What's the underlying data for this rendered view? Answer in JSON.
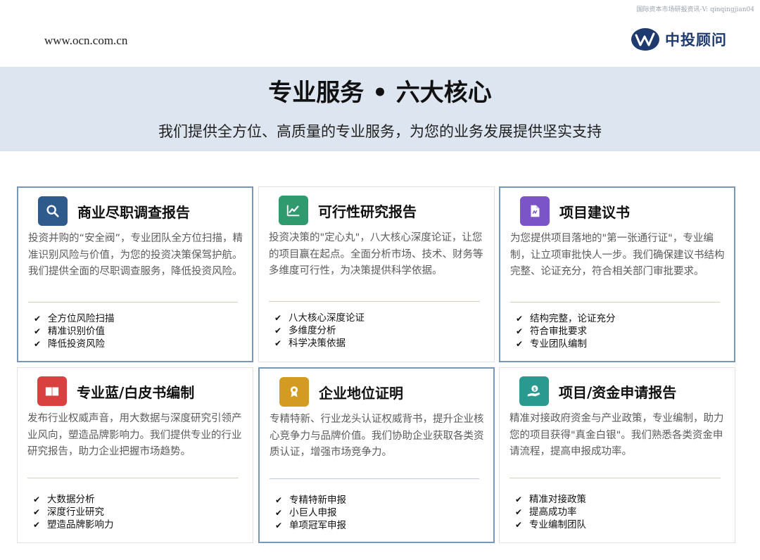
{
  "watermark": "国际资本市场研报资讯-V: qinqingjian04",
  "header": {
    "url": "www.ocn.com.cn",
    "brand_name": "中投顾问",
    "brand_color": "#1e3a6e"
  },
  "banner": {
    "title": "专业服务 • 六大核心",
    "subtitle": "我们提供全方位、高质量的专业服务，为您的业务发展提供坚实支持"
  },
  "cards": [
    {
      "title": "商业尽职调查报告",
      "icon": "search-icon",
      "icon_color": "#2f5a8c",
      "desc": "投资并购的“安全阀”，专业团队全方位扫描，精准识别风险与价值，为您的投资决策保驾护航。我们提供全面的尽职调查服务，降低投资风险。",
      "checks": [
        "全方位风险扫描",
        "精准识别价值",
        "降低投资风险"
      ]
    },
    {
      "title": "可行性研究报告",
      "icon": "line-chart-icon",
      "icon_color": "#2e9a6e",
      "desc": "投资决策的\"定心丸\"，八大核心深度论证，让您的项目赢在起点。全面分析市场、技术、财务等多维度可行性，为决策提供科学依据。",
      "checks": [
        "八大核心深度论证",
        "多维度分析",
        "科学决策依据"
      ]
    },
    {
      "title": "项目建议书",
      "icon": "document-icon",
      "icon_color": "#7b55c7",
      "desc": "为您提供项目落地的\"第一张通行证\"，专业编制，让立项审批快人一步。我们确保建议书结构完整、论证充分，符合相关部门审批要求。",
      "checks": [
        "结构完整，论证充分",
        "符合审批要求",
        "专业团队编制"
      ]
    },
    {
      "title": "专业蓝/白皮书编制",
      "icon": "book-icon",
      "icon_color": "#d94141",
      "desc": "发布行业权威声音，用大数据与深度研究引领产业风向，塑造品牌影响力。我们提供专业的行业研究报告，助力企业把握市场趋势。",
      "checks": [
        "大数据分析",
        "深度行业研究",
        "塑造品牌影响力"
      ]
    },
    {
      "title": "企业地位证明",
      "icon": "award-icon",
      "icon_color": "#d49b22",
      "desc": "专精特新、行业龙头认证权威背书，提升企业核心竞争力与品牌价值。我们协助企业获取各类资质认证，增强市场竞争力。",
      "checks": [
        "专精特新申报",
        "小巨人申报",
        "单项冠军申报"
      ]
    },
    {
      "title": "项目/资金申请报告",
      "icon": "money-hand-icon",
      "icon_color": "#2a9a91",
      "desc": "精准对接政府资金与产业政策，专业编制，助力您的项目获得\"真金白银\"。我们熟悉各类资金申请流程，提高申报成功率。",
      "checks": [
        "精准对接政策",
        "提高成功率",
        "专业编制团队"
      ]
    }
  ]
}
